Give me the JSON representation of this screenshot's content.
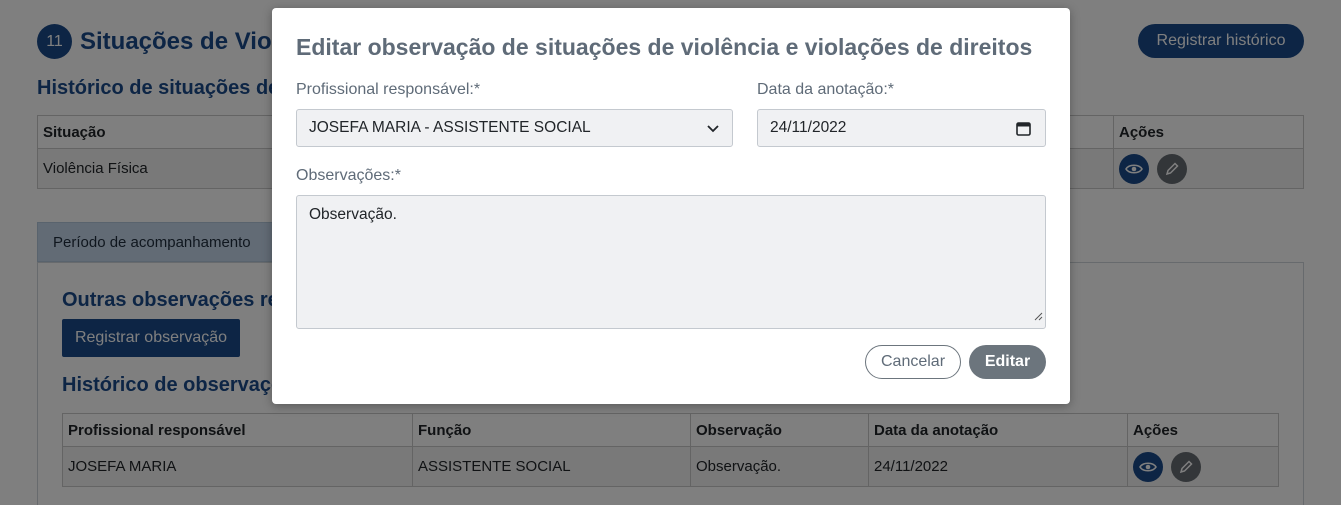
{
  "background": {
    "section_number": "11",
    "section_title": "Situações de Violência e violações de direitos",
    "register_history_button": "Registrar histórico",
    "history_title": "Histórico de situações de violência e violações de direitos",
    "situations_table": {
      "headers": [
        "Situação",
        "Ações"
      ],
      "rows": [
        {
          "situacao": "Violência Física"
        }
      ]
    },
    "tab_label": "Período de acompanhamento",
    "other_obs_title": "Outras observações referentes a situações de violência e violações de direitos",
    "register_obs_button": "Registrar observação",
    "obs_history_title": "Histórico de observações",
    "obs_table": {
      "headers": [
        "Profissional responsável",
        "Função",
        "Observação",
        "Data da anotação",
        "Ações"
      ],
      "rows": [
        {
          "profissional": "JOSEFA MARIA",
          "funcao": "ASSISTENTE SOCIAL",
          "observacao": "Observação.",
          "data": "24/11/2022"
        }
      ]
    },
    "icons": {
      "view": "eye-icon",
      "edit": "pencil-icon"
    }
  },
  "modal": {
    "title": "Editar observação de situações de violência e violações de direitos",
    "professional_label": "Profissional responsável:*",
    "professional_value": "JOSEFA MARIA - ASSISTENTE SOCIAL",
    "date_label": "Data da anotação:*",
    "date_value": "24/11/2022",
    "observations_label": "Observações:*",
    "observations_value": "Observação.",
    "cancel_button": "Cancelar",
    "edit_button": "Editar"
  },
  "colors": {
    "primary": "#1a4a8a",
    "secondary": "#6c757d",
    "overlay": "rgba(0,0,0,0.5)"
  }
}
